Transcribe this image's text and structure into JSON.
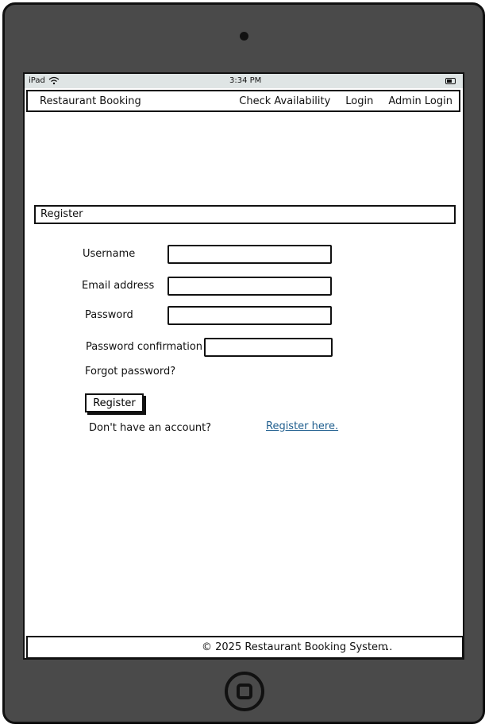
{
  "status_bar": {
    "device": "iPad",
    "time": "3:34 PM"
  },
  "navbar": {
    "brand": "Restaurant Booking",
    "links": [
      "Check Availability",
      "Login",
      "Admin Login"
    ]
  },
  "section_title": "Register",
  "form": {
    "username_label": "Username",
    "username_value": "",
    "email_label": "Email address",
    "email_value": "",
    "password_label": "Password",
    "password_value": "",
    "password_confirmation_label": "Password confirmation",
    "password_confirmation_value": "",
    "forgot_password": "Forgot password?",
    "submit_label": "Register",
    "no_account_text": "Don't have an account?",
    "register_link": "Register here."
  },
  "footer": {
    "text": "© 2025 Restaurant Booking System",
    "ellipsis": "..."
  }
}
